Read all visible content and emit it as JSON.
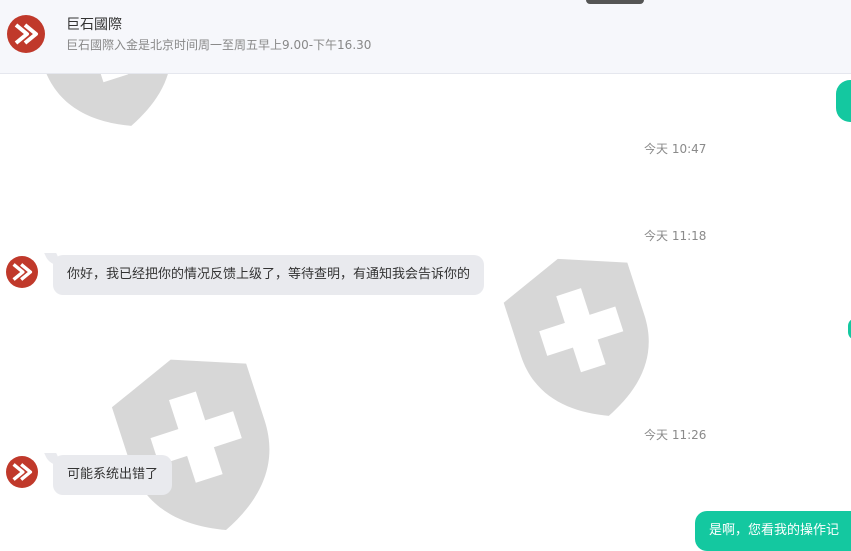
{
  "header": {
    "name": "巨石國際",
    "subtitle": "巨石國際入金是北京时间周一至周五早上9.00-下午16.30"
  },
  "messages": {
    "ts1": "今天 10:47",
    "ts2": "今天 11:18",
    "msg1": "你好，我已经把你的情况反馈上级了，等待查明，有通知我会告诉你的",
    "ts3": "今天 11:26",
    "msg2": "可能系统出错了",
    "msg3": "是啊，您看我的操作记"
  },
  "colors": {
    "accent": "#14c8a0",
    "avatar": "#c0392b",
    "incoming_bubble": "#e9eaee",
    "header_bg": "#f6f7fb"
  },
  "icons": {
    "avatar": "brand-logo-icon",
    "watermark": "shield-cross-watermark"
  }
}
